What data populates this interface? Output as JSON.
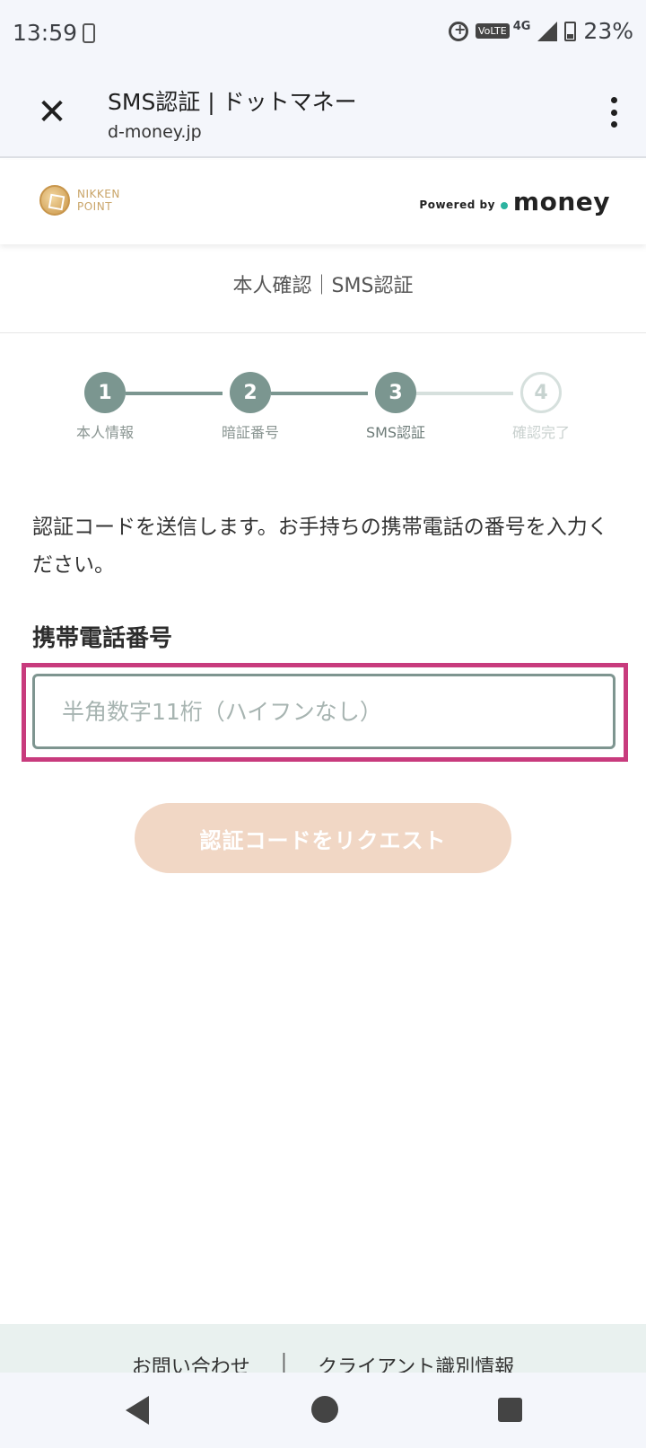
{
  "status_bar": {
    "time": "13:59",
    "volte": "VoLTE",
    "network": "4G",
    "battery": "23%"
  },
  "browser": {
    "title": "SMS認証 | ドットマネー",
    "url": "d-money.jp"
  },
  "header": {
    "logo_line1": "NIKKEN",
    "logo_line2": "POINT",
    "powered_label": "Powered by",
    "brand": "money"
  },
  "section_title": "本人確認｜SMS認証",
  "steps": [
    {
      "number": "1",
      "label": "本人情報",
      "state": "done"
    },
    {
      "number": "2",
      "label": "暗証番号",
      "state": "done"
    },
    {
      "number": "3",
      "label": "SMS認証",
      "state": "current"
    },
    {
      "number": "4",
      "label": "確認完了",
      "state": "pending"
    }
  ],
  "instruction": "認証コードを送信します。お手持ちの携帯電話の番号を入力ください。",
  "phone": {
    "label": "携帯電話番号",
    "placeholder": "半角数字11桁（ハイフンなし）",
    "value": ""
  },
  "request_button": "認証コードをリクエスト",
  "footer": {
    "contact": "お問い合わせ",
    "separator": "|",
    "client_info": "クライアント識別情報"
  },
  "colors": {
    "accent": "#7b9690",
    "highlight": "#c83b7d",
    "button_disabled": "#f1d7c5",
    "money_dot": "#2cb3a0"
  }
}
